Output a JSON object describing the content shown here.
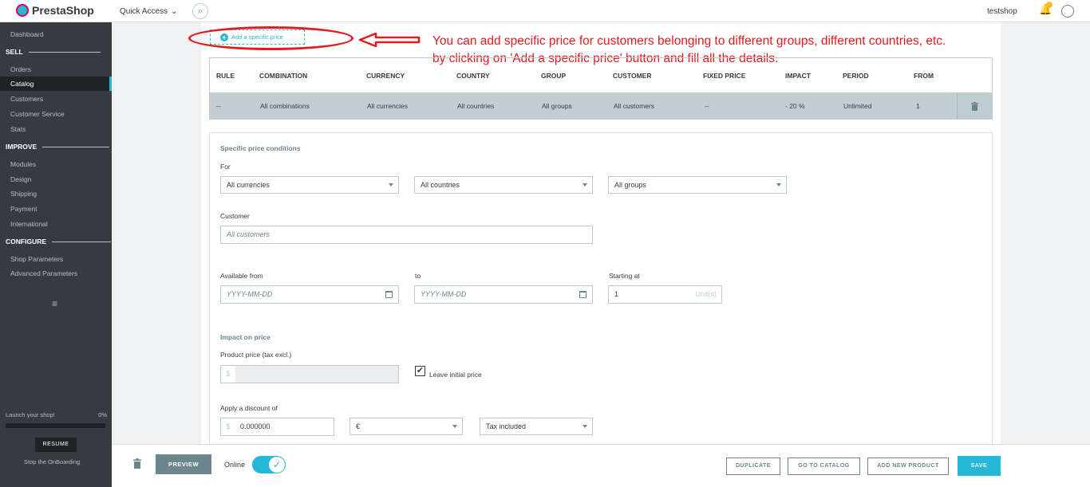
{
  "topbar": {
    "brand": "PrestaShop",
    "quick_access": "Quick Access",
    "shop_name": "testshop"
  },
  "sidebar": {
    "dashboard": "Dashboard",
    "sections": [
      {
        "title": "SELL",
        "items": [
          "Orders",
          "Catalog",
          "Customers",
          "Customer Service",
          "Stats"
        ]
      },
      {
        "title": "IMPROVE",
        "items": [
          "Modules",
          "Design",
          "Shipping",
          "Payment",
          "International"
        ]
      },
      {
        "title": "CONFIGURE",
        "items": [
          "Shop Parameters",
          "Advanced Parameters"
        ]
      }
    ],
    "launch_label": "Launch your shop!",
    "launch_progress": "0%",
    "resume": "RESUME",
    "stop_onboarding": "Stop the OnBoarding"
  },
  "add_specific_price": "Add a specific price",
  "annotation": {
    "line1": "You can add specific price for customers belonging to different groups, different countries, etc.",
    "line2": "by clicking on 'Add a specific price' button and fill all the details."
  },
  "table": {
    "headers": [
      "RULE",
      "COMBINATION",
      "CURRENCY",
      "COUNTRY",
      "GROUP",
      "CUSTOMER",
      "FIXED PRICE",
      "IMPACT",
      "PERIOD",
      "FROM"
    ],
    "row": [
      "--",
      "All combinations",
      "All currencies",
      "All countries",
      "All groups",
      "All customers",
      "--",
      "- 20 %",
      "Unlimited",
      "1"
    ]
  },
  "conditions": {
    "title": "Specific price conditions",
    "for_label": "For",
    "currency": "All currencies",
    "country": "All countries",
    "group": "All groups",
    "customer_label": "Customer",
    "customer_placeholder": "All customers",
    "available_from_label": "Available from",
    "to_label": "to",
    "starting_at_label": "Starting at",
    "date_placeholder": "YYYY-MM-DD",
    "starting_at_value": "1",
    "unit": "Unit(s)"
  },
  "impact": {
    "title": "Impact on price",
    "product_price_label": "Product price (tax excl.)",
    "currency_symbol": "$",
    "leave_initial_label": "Leave initial price",
    "discount_label": "Apply a discount of",
    "discount_value": "0.000000",
    "discount_type": "€",
    "tax_mode": "Tax included"
  },
  "bottombar": {
    "preview": "PREVIEW",
    "online": "Online",
    "duplicate": "DUPLICATE",
    "go_to_catalog": "GO TO CATALOG",
    "add_new_product": "ADD NEW PRODUCT",
    "save": "SAVE"
  },
  "colors": {
    "accent": "#25b9d7",
    "annotation": "#e41a1c",
    "sidebar": "#363a41"
  }
}
